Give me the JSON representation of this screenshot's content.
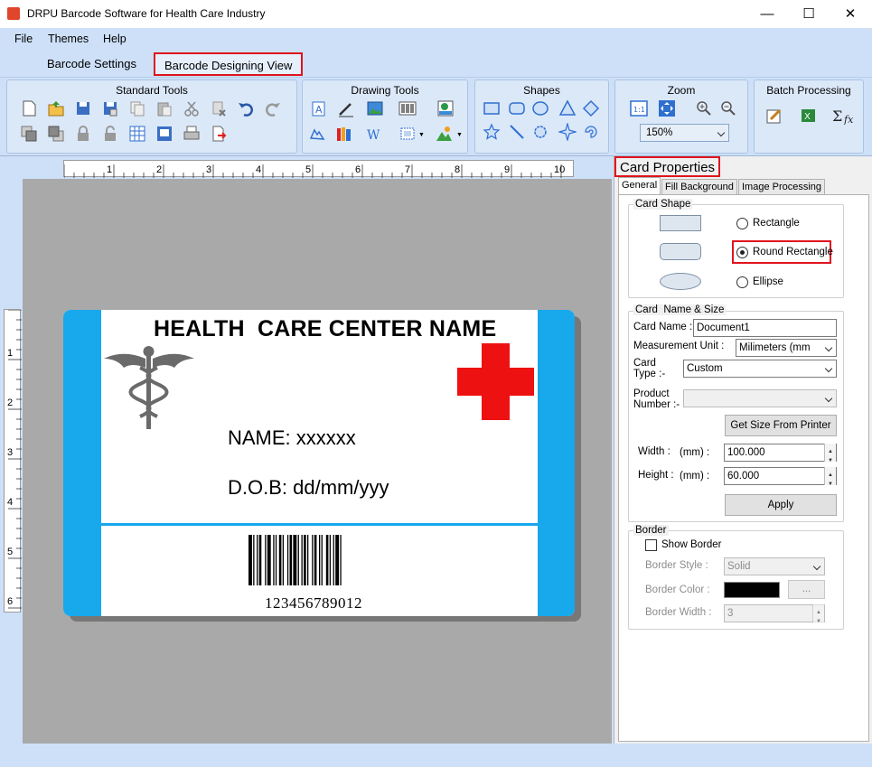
{
  "window": {
    "title": "DRPU Barcode Software for Health Care Industry"
  },
  "menu": {
    "items": [
      "File",
      "Themes",
      "Help"
    ]
  },
  "tabs": {
    "barcode_settings": "Barcode Settings",
    "designing_view": "Barcode Designing View"
  },
  "ribbon": {
    "standard_tools": "Standard Tools",
    "drawing_tools": "Drawing Tools",
    "shapes": "Shapes",
    "zoom": "Zoom",
    "zoom_value": "150%",
    "batch_processing": "Batch Processing"
  },
  "ruler": {
    "h_ticks": [
      "1",
      "2",
      "3",
      "4",
      "5",
      "6",
      "7",
      "8",
      "9",
      "10"
    ],
    "v_ticks": [
      "1",
      "2",
      "3",
      "4",
      "5",
      "6"
    ]
  },
  "card": {
    "header": "HEALTH  CARE CENTER NAME",
    "name_line": "NAME: xxxxxx",
    "dob_line": "D.O.B: dd/mm/yyy",
    "barcode_number": "123456789012",
    "accent": "#18a8ec",
    "cross_color": "#ee1111"
  },
  "panel": {
    "title": "Card Properties",
    "tabs": [
      "General",
      "Fill Background",
      "Image Processing"
    ],
    "card_shape": {
      "legend": "Card Shape",
      "options": [
        "Rectangle",
        "Round Rectangle",
        "Ellipse"
      ],
      "selected": "Round Rectangle"
    },
    "name_size": {
      "legend": "Card  Name & Size",
      "card_name_label": "Card Name :",
      "card_name_value": "Document1",
      "measurement_label": "Measurement Unit :",
      "measurement_value": "Milimeters (mm",
      "card_type_label": "Card\nType :-",
      "card_type_value": "Custom",
      "product_label": "Product\nNumber :-",
      "get_size_button": "Get Size From Printer",
      "width_label": "Width :",
      "width_unit": "(mm) :",
      "width_value": "100.000",
      "height_label": "Height :",
      "height_unit": "(mm) :",
      "height_value": "60.000",
      "apply_button": "Apply"
    },
    "border": {
      "legend": "Border",
      "show_border": "Show Border",
      "style_label": "Border Style :",
      "style_value": "Solid",
      "color_label": "Border Color :",
      "color_button": "...",
      "width_label": "Border Width :",
      "width_value": "3"
    }
  }
}
